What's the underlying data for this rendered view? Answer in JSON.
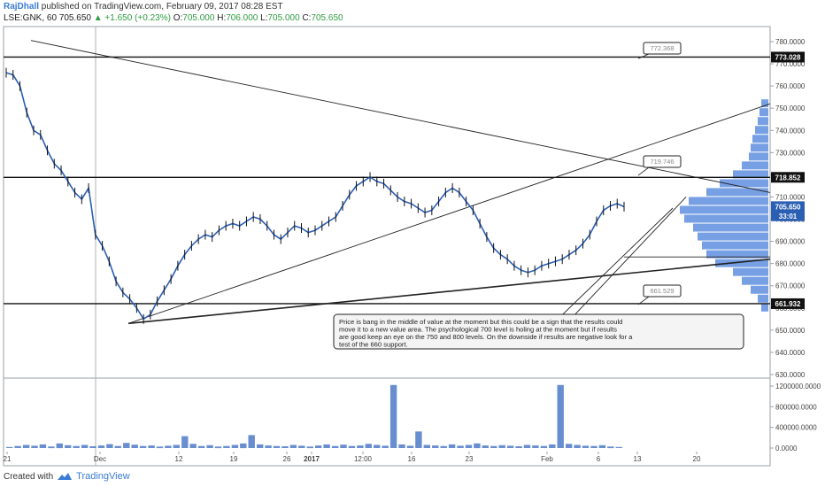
{
  "header": {
    "author": "RajDhall",
    "published": "published on TradingView.com, February 09, 2017 08:28 EST",
    "symbol": "LSE:GNK, 60",
    "last": "705.650",
    "change": "▲ +1.650 (+0.23%)",
    "o_label": "O:",
    "o_value": "705.000",
    "h_label": "H:",
    "h_value": "706.000",
    "l_label": "L:",
    "l_value": "705.000",
    "c_label": "C:",
    "c_value": "705.650"
  },
  "footer": {
    "created_with": "Created with",
    "brand": "TradingView"
  },
  "colors": {
    "up": "#2e9c40",
    "price_line": "#2b5fb4",
    "volume": "#4472c4",
    "profile": "#4a7fd9",
    "accent": "#3a7bd5"
  },
  "chart_data": {
    "type": "line",
    "ylim": [
      630,
      780
    ],
    "y_ticks": [
      "630.0000",
      "640.0000",
      "650.0000",
      "660.0000",
      "670.0000",
      "680.0000",
      "690.0000",
      "700.0000",
      "710.0000",
      "720.0000",
      "730.0000",
      "740.0000",
      "750.0000",
      "760.0000",
      "770.0000",
      "780.0000"
    ],
    "y_tick_values": [
      630,
      640,
      650,
      660,
      670,
      680,
      690,
      700,
      710,
      720,
      730,
      740,
      750,
      760,
      770,
      780
    ],
    "x_ticks": [
      "21",
      "Dec",
      "12",
      "19",
      "26",
      "2017",
      "12:00",
      "16",
      "23",
      "Feb",
      "6",
      "13",
      "20"
    ],
    "price_series": {
      "name": "",
      "values": [
        766,
        765,
        760,
        748,
        740,
        738,
        731,
        725,
        722,
        717,
        712,
        709,
        714,
        693,
        688,
        681,
        672,
        667,
        664,
        660,
        655,
        657,
        663,
        668,
        673,
        679,
        684,
        688,
        691,
        693,
        692,
        695,
        697,
        698,
        697,
        699,
        701,
        700,
        697,
        693,
        691,
        694,
        697,
        696,
        694,
        695,
        697,
        699,
        701,
        706,
        711,
        715,
        717,
        719,
        717,
        716,
        713,
        710,
        708,
        707,
        705,
        703,
        704,
        708,
        712,
        714,
        712,
        708,
        704,
        698,
        692,
        687,
        684,
        682,
        679,
        677,
        676,
        677,
        679,
        680,
        681,
        682,
        684,
        686,
        689,
        693,
        699,
        704,
        706,
        707,
        705.65
      ]
    },
    "price_labels": [
      {
        "text": "773.028",
        "value": 773.028
      },
      {
        "text": "718.852",
        "value": 718.852
      },
      {
        "text": "705.650",
        "value": 705.65
      },
      {
        "text": "33:01",
        "value": 701.5
      },
      {
        "text": "661.932",
        "value": 661.932
      }
    ],
    "levels": [
      773.028,
      718.852,
      661.932
    ],
    "callouts": [
      {
        "text": "772.368",
        "value": 772.368
      },
      {
        "text": "719.746",
        "value": 719.746
      },
      {
        "text": "661.529",
        "value": 661.529
      }
    ],
    "volume": {
      "ylim": [
        0,
        1300000
      ],
      "y_ticks": [
        "0.0000",
        "400000.0000",
        "800000.0000",
        "1200000.0000"
      ],
      "y_tick_values": [
        0,
        400000,
        800000,
        1200000
      ],
      "values": [
        20000,
        40000,
        60000,
        45000,
        70000,
        30000,
        90000,
        55000,
        40000,
        60000,
        35000,
        50000,
        75000,
        40000,
        100000,
        65000,
        40000,
        50000,
        30000,
        45000,
        60000,
        230000,
        80000,
        40000,
        55000,
        30000,
        40000,
        60000,
        90000,
        250000,
        70000,
        50000,
        40000,
        35000,
        60000,
        45000,
        30000,
        50000,
        70000,
        40000,
        65000,
        40000,
        50000,
        80000,
        60000,
        45000,
        1220000,
        70000,
        45000,
        320000,
        60000,
        50000,
        40000,
        70000,
        45000,
        60000,
        90000,
        50000,
        40000,
        55000,
        45000,
        35000,
        60000,
        50000,
        40000,
        70000,
        1220000,
        80000,
        60000,
        45000,
        40000,
        55000,
        30000,
        20000
      ]
    },
    "volume_profile": [
      {
        "price": 752,
        "vol": 8
      },
      {
        "price": 748,
        "vol": 10
      },
      {
        "price": 744,
        "vol": 12
      },
      {
        "price": 740,
        "vol": 15
      },
      {
        "price": 736,
        "vol": 18
      },
      {
        "price": 732,
        "vol": 20
      },
      {
        "price": 728,
        "vol": 22
      },
      {
        "price": 724,
        "vol": 30
      },
      {
        "price": 720,
        "vol": 40
      },
      {
        "price": 716,
        "vol": 55
      },
      {
        "price": 712,
        "vol": 70
      },
      {
        "price": 708,
        "vol": 90
      },
      {
        "price": 704,
        "vol": 100
      },
      {
        "price": 700,
        "vol": 95
      },
      {
        "price": 696,
        "vol": 85
      },
      {
        "price": 692,
        "vol": 80
      },
      {
        "price": 688,
        "vol": 75
      },
      {
        "price": 684,
        "vol": 70
      },
      {
        "price": 680,
        "vol": 60
      },
      {
        "price": 676,
        "vol": 40
      },
      {
        "price": 672,
        "vol": 30
      },
      {
        "price": 668,
        "vol": 20
      },
      {
        "price": 664,
        "vol": 12
      },
      {
        "price": 660,
        "vol": 8
      }
    ],
    "annotation": "Price is bang in the middle of value at the moment but this could be a sign that the results could move it to a new value area. The psychological 700 level is holing at the moment but if results are good keep an eye on the 750 and 800 levels. On the downside if results are negative look for a test of the 660 support."
  }
}
